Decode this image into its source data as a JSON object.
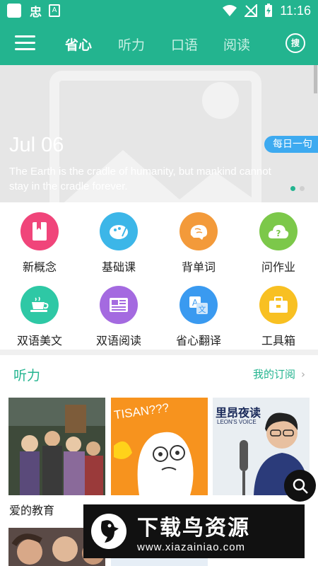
{
  "statusbar": {
    "time": "11:16",
    "a_glyph": "A",
    "app_glyph": "忠"
  },
  "header": {
    "tabs": [
      {
        "label": "省心",
        "active": true
      },
      {
        "label": "听力",
        "active": false
      },
      {
        "label": "口语",
        "active": false
      },
      {
        "label": "阅读",
        "active": false
      }
    ],
    "search_label": "搜"
  },
  "banner": {
    "date": "Jul 06",
    "quote": "The Earth is the cradle of humanity, but mankind cannot stay in the cradle forever.",
    "daily_tag": "每日一句"
  },
  "features": [
    {
      "label": "新概念",
      "color": "#f0457a",
      "icon": "book-icon"
    },
    {
      "label": "基础课",
      "color": "#3cb6e8",
      "icon": "palette-icon"
    },
    {
      "label": "背单词",
      "color": "#f39a3a",
      "icon": "brain-icon"
    },
    {
      "label": "问作业",
      "color": "#7cc84a",
      "icon": "question-cloud-icon"
    },
    {
      "label": "双语美文",
      "color": "#2ec8a5",
      "icon": "coffee-cup-icon"
    },
    {
      "label": "双语阅读",
      "color": "#a46ae0",
      "icon": "newspaper-icon"
    },
    {
      "label": "省心翻译",
      "color": "#3a9af0",
      "icon": "translate-icon"
    },
    {
      "label": "工具箱",
      "color": "#f8c022",
      "icon": "toolbox-icon"
    }
  ],
  "listening": {
    "title": "听力",
    "subscriptions": "我的订阅",
    "cards": [
      {
        "title": "爱的教育"
      },
      {
        "title": "",
        "art_text": "TISAN???"
      },
      {
        "title": "",
        "art_text": "里昂夜读",
        "art_sub": "LEON'S VOICE"
      }
    ]
  },
  "watermark": {
    "text": "下载鸟资源",
    "url": "www.xiazainiao.com"
  }
}
